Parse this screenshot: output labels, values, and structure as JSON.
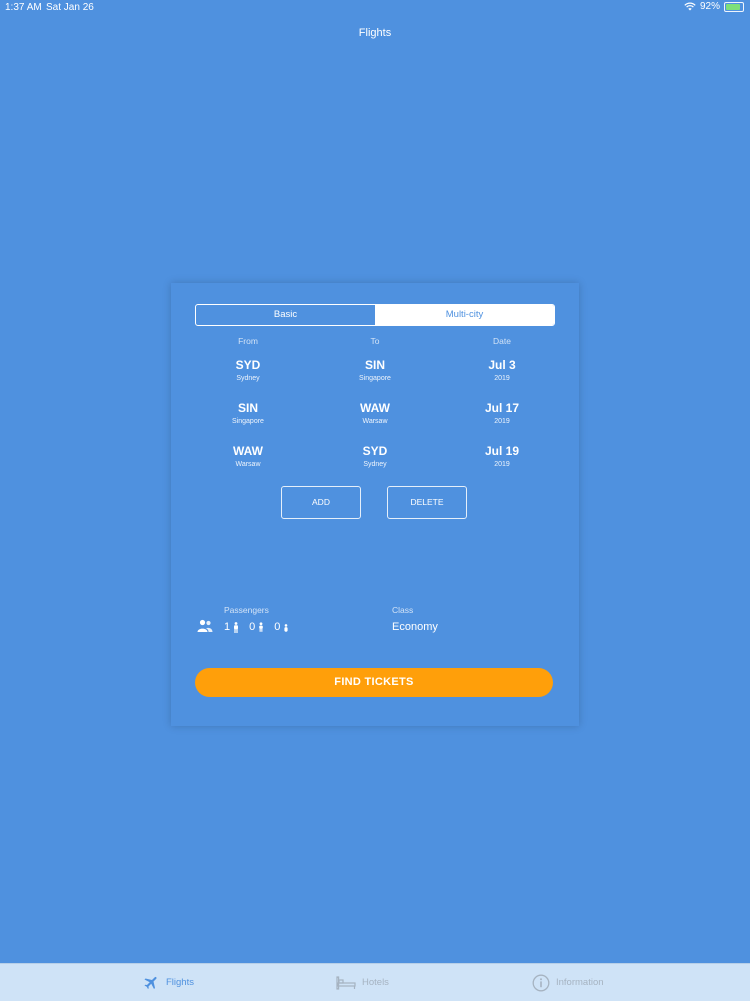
{
  "status": {
    "time": "1:37 AM",
    "date": "Sat Jan 26",
    "battery": "92%"
  },
  "nav": {
    "title": "Flights"
  },
  "segment": {
    "options": [
      "Basic",
      "Multi-city"
    ],
    "selected": "Multi-city"
  },
  "columns": {
    "from": "From",
    "to": "To",
    "date": "Date"
  },
  "legs": [
    {
      "from_code": "SYD",
      "from_city": "Sydney",
      "to_code": "SIN",
      "to_city": "Singapore",
      "date": "Jul 3",
      "year": "2019"
    },
    {
      "from_code": "SIN",
      "from_city": "Singapore",
      "to_code": "WAW",
      "to_city": "Warsaw",
      "date": "Jul 17",
      "year": "2019"
    },
    {
      "from_code": "WAW",
      "from_city": "Warsaw",
      "to_code": "SYD",
      "to_city": "Sydney",
      "date": "Jul 19",
      "year": "2019"
    }
  ],
  "actions": {
    "add": "ADD",
    "delete": "DELETE"
  },
  "passengers": {
    "label": "Passengers",
    "adults": "1",
    "children": "0",
    "infants": "0"
  },
  "class": {
    "label": "Class",
    "value": "Economy"
  },
  "find": {
    "label": "FIND TICKETS"
  },
  "tabs": [
    {
      "label": "Flights",
      "icon": "airplane-icon",
      "active": true
    },
    {
      "label": "Hotels",
      "icon": "bed-icon",
      "active": false
    },
    {
      "label": "Information",
      "icon": "info-icon",
      "active": false
    }
  ],
  "colors": {
    "background": "#4f91df",
    "accent": "#ff9f0a",
    "tab_bar": "#cfe3f7"
  }
}
